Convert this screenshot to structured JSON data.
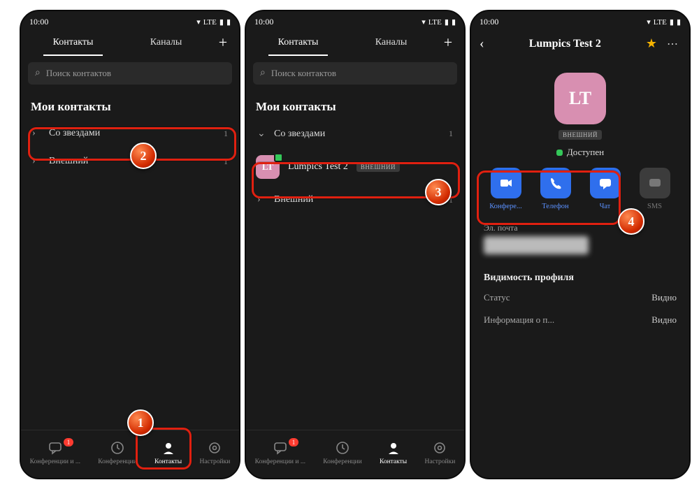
{
  "status_time": "10:00",
  "status_net": "LTE",
  "top_tabs": {
    "contacts": "Контакты",
    "channels": "Каналы"
  },
  "search_placeholder": "Поиск контактов",
  "section_title": "Мои контакты",
  "groups": {
    "starred": {
      "label": "Со звездами",
      "count": "1"
    },
    "external": {
      "label": "Внешний",
      "count": "1"
    }
  },
  "contact": {
    "initials": "LT",
    "name": "Lumpics Test 2",
    "badge": "ВНЕШНИЙ",
    "status": "Доступен"
  },
  "bottom_nav": {
    "meetings_chat": "Конференции и ...",
    "meetings": "Конференции",
    "contacts": "Контакты",
    "settings": "Настройки",
    "badge": "1"
  },
  "profile_title": "Lumpics Test 2",
  "actions": {
    "conference": "Конфере...",
    "phone": "Телефон",
    "chat": "Чат",
    "sms": "SMS"
  },
  "email_label": "Эл. почта",
  "visibility_title": "Видимость профиля",
  "visibility": {
    "status_label": "Статус",
    "status_value": "Видно",
    "info_label": "Информация о п...",
    "info_value": "Видно"
  }
}
